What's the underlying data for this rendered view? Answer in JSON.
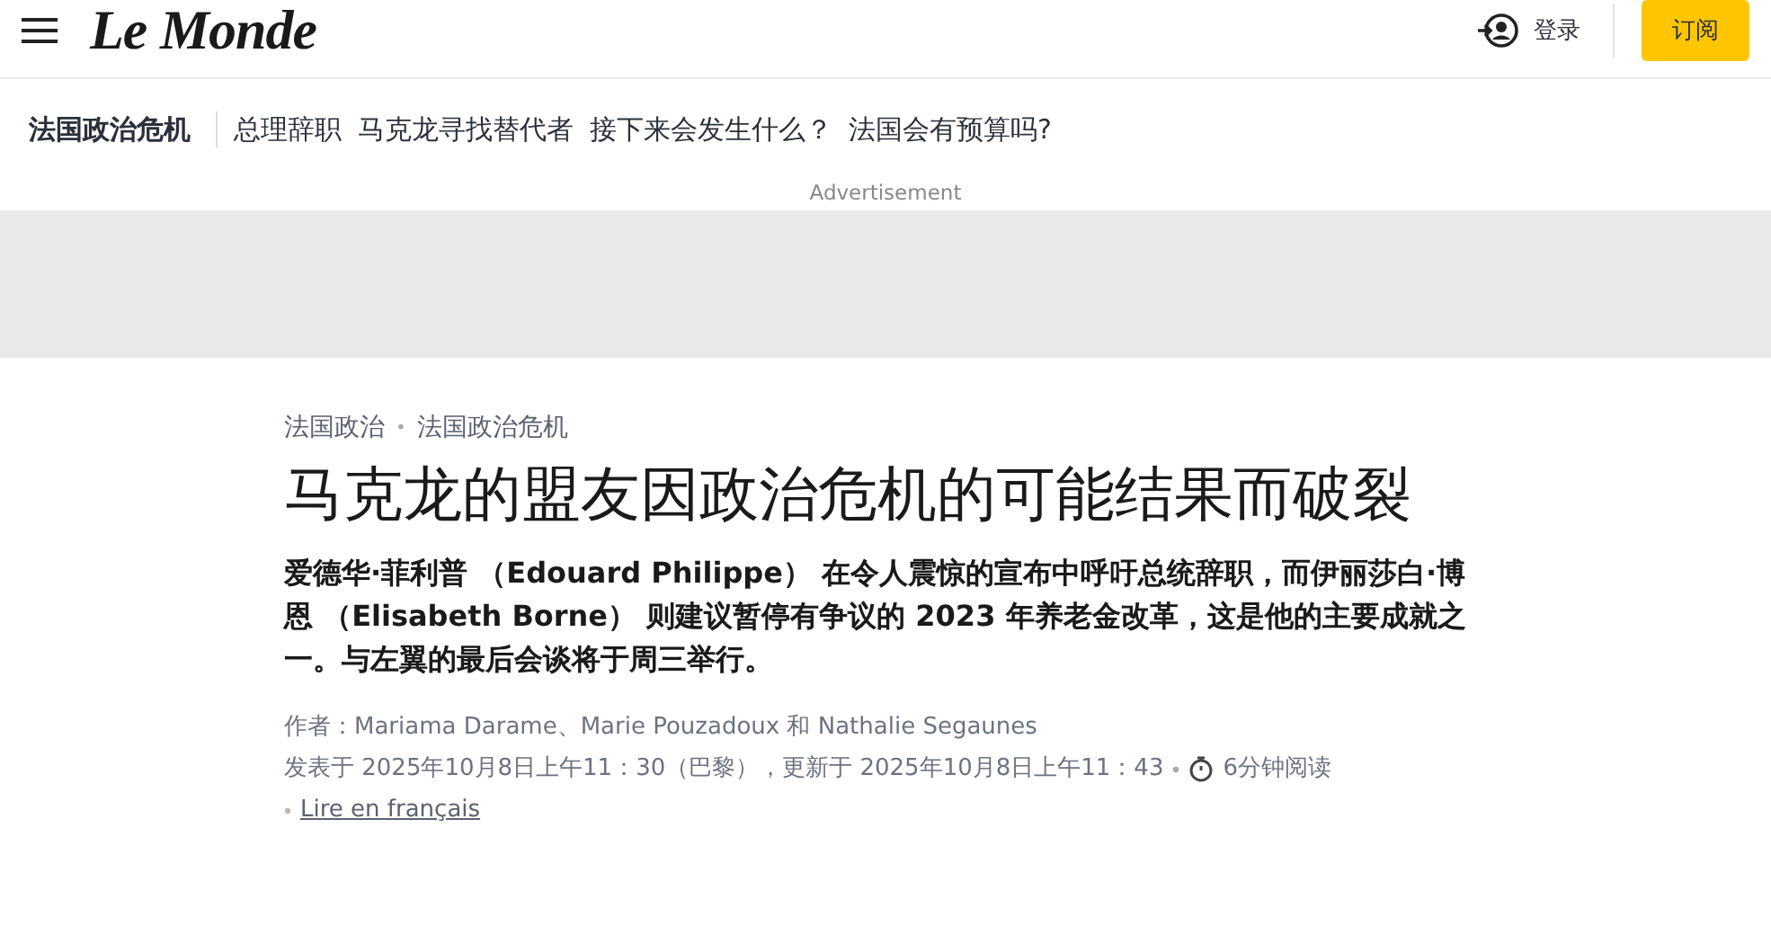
{
  "header": {
    "logo": "Le Monde",
    "login": "登录",
    "subscribe": "订阅"
  },
  "subnav": {
    "section": "法国政治危机",
    "links": [
      "总理辞职",
      "马克龙寻找替代者",
      "接下来会发生什么？",
      "法国会有预算吗?"
    ]
  },
  "ad": {
    "label": "Advertisement"
  },
  "article": {
    "breadcrumbs": [
      "法国政治",
      "法国政治危机"
    ],
    "separator": "•",
    "title": "马克龙的盟友因政治危机的可能结果而破裂",
    "lead": "爱德华·菲利普 （Edouard Philippe） 在令人震惊的宣布中呼吁总统辞职，而伊丽莎白·博恩 （Elisabeth Borne） 则建议暂停有争议的 2023 年养老金改革，这是他的主要成就之一。与左翼的最后会谈将于周三举行。",
    "authors": "作者：Mariama Darame、Marie Pouzadoux 和 Nathalie Segaunes",
    "dates": "发表于 2025年10月8日上午11：30（巴黎），更新于 2025年10月8日上午11：43",
    "reading_time": "6分钟阅读",
    "translation_link": "Lire en français"
  }
}
